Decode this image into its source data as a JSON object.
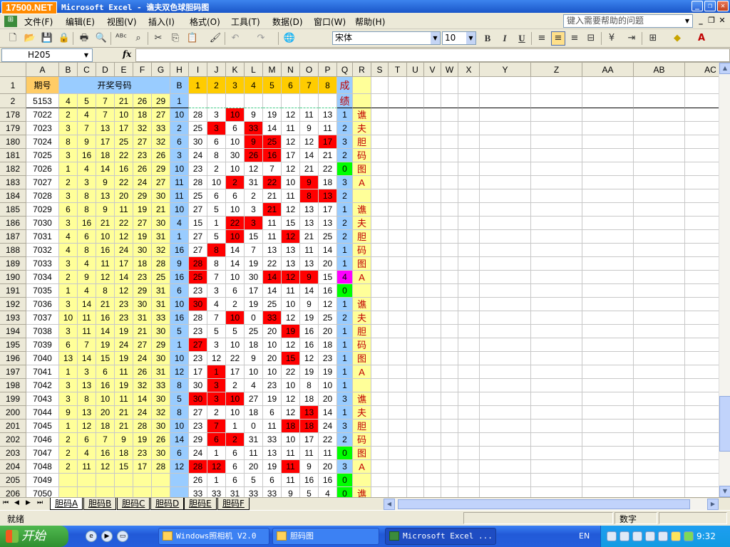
{
  "title_bar": {
    "logo_text": "17500.NET",
    "title": "Microsoft Excel - 谯夫双色球胆码图",
    "window_buttons": [
      "_",
      "❐",
      "✕"
    ]
  },
  "menu": {
    "items": [
      "文件(F)",
      "编辑(E)",
      "视图(V)",
      "插入(I)",
      "格式(O)",
      "工具(T)",
      "数据(D)",
      "窗口(W)",
      "帮助(H)"
    ],
    "help_placeholder": "键入需要帮助的问题",
    "mdi_buttons": [
      "_",
      "❐",
      "✕"
    ]
  },
  "toolbar": {
    "font_name": "宋体",
    "font_size": "10",
    "bold": "B",
    "italic": "I",
    "underline": "U"
  },
  "formula_bar": {
    "cell_ref": "H205",
    "fx": "fx",
    "content": ""
  },
  "columns": [
    "A",
    "B",
    "C",
    "D",
    "E",
    "F",
    "G",
    "H",
    "I",
    "J",
    "K",
    "L",
    "M",
    "N",
    "O",
    "P",
    "Q",
    "R",
    "S",
    "T",
    "U",
    "V",
    "W",
    "X",
    "Y",
    "Z",
    "AA",
    "AB",
    "AC"
  ],
  "header_rows": [
    {
      "row": "1",
      "label_a": "期号",
      "label_bg": "开奖号码",
      "label_h": "B",
      "cols_ip": [
        "1",
        "2",
        "3",
        "4",
        "5",
        "6",
        "7",
        "8"
      ],
      "label_q": "成"
    },
    {
      "row": "2",
      "a": "5153",
      "bg": [
        "4",
        "5",
        "7",
        "21",
        "26",
        "29"
      ],
      "h": "1",
      "label_q": "绩"
    }
  ],
  "rows": [
    {
      "n": "178",
      "a": "7022",
      "bg": [
        "2",
        "4",
        "7",
        "10",
        "18",
        "27"
      ],
      "h": "10",
      "ip": [
        "28",
        "3",
        "10",
        "9",
        "19",
        "12",
        "11",
        "13"
      ],
      "red": [
        2
      ],
      "q": "1",
      "qc": "b",
      "r": "谯"
    },
    {
      "n": "179",
      "a": "7023",
      "bg": [
        "3",
        "7",
        "13",
        "17",
        "32",
        "33"
      ],
      "h": "2",
      "ip": [
        "25",
        "3",
        "6",
        "33",
        "14",
        "11",
        "9",
        "11"
      ],
      "red": [
        1,
        3
      ],
      "q": "2",
      "qc": "b",
      "r": "夫"
    },
    {
      "n": "180",
      "a": "7024",
      "bg": [
        "8",
        "9",
        "17",
        "25",
        "27",
        "32"
      ],
      "h": "6",
      "ip": [
        "30",
        "6",
        "10",
        "9",
        "25",
        "12",
        "12",
        "17"
      ],
      "red": [
        3,
        4,
        7
      ],
      "q": "3",
      "qc": "b",
      "r": "胆"
    },
    {
      "n": "181",
      "a": "7025",
      "bg": [
        "3",
        "16",
        "18",
        "22",
        "23",
        "26"
      ],
      "h": "3",
      "ip": [
        "24",
        "8",
        "30",
        "26",
        "16",
        "17",
        "14",
        "21"
      ],
      "red": [
        3,
        4
      ],
      "q": "2",
      "qc": "b",
      "r": "码"
    },
    {
      "n": "182",
      "a": "7026",
      "bg": [
        "1",
        "4",
        "14",
        "16",
        "26",
        "29"
      ],
      "h": "10",
      "ip": [
        "23",
        "2",
        "10",
        "12",
        "7",
        "12",
        "21",
        "22"
      ],
      "red": [],
      "q": "0",
      "qc": "g",
      "r": "图"
    },
    {
      "n": "183",
      "a": "7027",
      "bg": [
        "2",
        "3",
        "9",
        "22",
        "24",
        "27"
      ],
      "h": "11",
      "ip": [
        "28",
        "10",
        "2",
        "31",
        "22",
        "10",
        "9",
        "18"
      ],
      "red": [
        2,
        4,
        6
      ],
      "q": "3",
      "qc": "b",
      "r": "A"
    },
    {
      "n": "184",
      "a": "7028",
      "bg": [
        "3",
        "8",
        "13",
        "20",
        "29",
        "30"
      ],
      "h": "11",
      "ip": [
        "25",
        "6",
        "6",
        "2",
        "21",
        "11",
        "8",
        "13"
      ],
      "red": [
        6,
        7
      ],
      "q": "2",
      "qc": "b",
      "r": ""
    },
    {
      "n": "185",
      "a": "7029",
      "bg": [
        "6",
        "8",
        "9",
        "11",
        "19",
        "21"
      ],
      "h": "10",
      "ip": [
        "27",
        "5",
        "10",
        "3",
        "21",
        "12",
        "13",
        "17"
      ],
      "red": [
        4
      ],
      "q": "1",
      "qc": "b",
      "r": "谯"
    },
    {
      "n": "186",
      "a": "7030",
      "bg": [
        "3",
        "16",
        "21",
        "22",
        "27",
        "30"
      ],
      "h": "4",
      "ip": [
        "15",
        "1",
        "22",
        "3",
        "11",
        "15",
        "13",
        "13"
      ],
      "red": [
        2,
        3
      ],
      "q": "2",
      "qc": "b",
      "r": "夫"
    },
    {
      "n": "187",
      "a": "7031",
      "bg": [
        "4",
        "6",
        "10",
        "12",
        "19",
        "31"
      ],
      "h": "1",
      "ip": [
        "27",
        "5",
        "10",
        "15",
        "11",
        "12",
        "21",
        "25"
      ],
      "red": [
        2,
        5
      ],
      "q": "2",
      "qc": "b",
      "r": "胆"
    },
    {
      "n": "188",
      "a": "7032",
      "bg": [
        "4",
        "8",
        "16",
        "24",
        "30",
        "32"
      ],
      "h": "16",
      "ip": [
        "27",
        "8",
        "14",
        "7",
        "13",
        "13",
        "11",
        "14"
      ],
      "red": [
        1
      ],
      "q": "1",
      "qc": "b",
      "r": "码"
    },
    {
      "n": "189",
      "a": "7033",
      "bg": [
        "3",
        "4",
        "11",
        "17",
        "18",
        "28"
      ],
      "h": "9",
      "ip": [
        "28",
        "8",
        "14",
        "19",
        "22",
        "13",
        "13",
        "20"
      ],
      "red": [
        0
      ],
      "q": "1",
      "qc": "b",
      "r": "图"
    },
    {
      "n": "190",
      "a": "7034",
      "bg": [
        "2",
        "9",
        "12",
        "14",
        "23",
        "25"
      ],
      "h": "16",
      "ip": [
        "25",
        "7",
        "10",
        "30",
        "14",
        "12",
        "9",
        "15"
      ],
      "red": [
        0,
        4,
        5,
        6
      ],
      "q": "4",
      "qc": "m",
      "r": "A"
    },
    {
      "n": "191",
      "a": "7035",
      "bg": [
        "1",
        "4",
        "8",
        "12",
        "29",
        "31"
      ],
      "h": "6",
      "ip": [
        "23",
        "3",
        "6",
        "17",
        "14",
        "11",
        "14",
        "16"
      ],
      "red": [],
      "q": "0",
      "qc": "g",
      "r": ""
    },
    {
      "n": "192",
      "a": "7036",
      "bg": [
        "3",
        "14",
        "21",
        "23",
        "30",
        "31"
      ],
      "h": "10",
      "ip": [
        "30",
        "4",
        "2",
        "19",
        "25",
        "10",
        "9",
        "12"
      ],
      "red": [
        0
      ],
      "q": "1",
      "qc": "b",
      "r": "谯"
    },
    {
      "n": "193",
      "a": "7037",
      "bg": [
        "10",
        "11",
        "16",
        "23",
        "31",
        "33"
      ],
      "h": "16",
      "ip": [
        "28",
        "7",
        "10",
        "0",
        "33",
        "12",
        "19",
        "25"
      ],
      "red": [
        2,
        4
      ],
      "q": "2",
      "qc": "b",
      "r": "夫"
    },
    {
      "n": "194",
      "a": "7038",
      "bg": [
        "3",
        "11",
        "14",
        "19",
        "21",
        "30"
      ],
      "h": "5",
      "ip": [
        "23",
        "5",
        "5",
        "25",
        "20",
        "19",
        "16",
        "20"
      ],
      "red": [
        5
      ],
      "q": "1",
      "qc": "b",
      "r": "胆"
    },
    {
      "n": "195",
      "a": "7039",
      "bg": [
        "6",
        "7",
        "19",
        "24",
        "27",
        "29"
      ],
      "h": "1",
      "ip": [
        "27",
        "3",
        "10",
        "18",
        "10",
        "12",
        "16",
        "18"
      ],
      "red": [
        0
      ],
      "q": "1",
      "qc": "b",
      "r": "码"
    },
    {
      "n": "196",
      "a": "7040",
      "bg": [
        "13",
        "14",
        "15",
        "19",
        "24",
        "30"
      ],
      "h": "10",
      "ip": [
        "23",
        "12",
        "22",
        "9",
        "20",
        "15",
        "12",
        "23"
      ],
      "red": [
        5
      ],
      "q": "1",
      "qc": "b",
      "r": "图"
    },
    {
      "n": "197",
      "a": "7041",
      "bg": [
        "1",
        "3",
        "6",
        "11",
        "26",
        "31"
      ],
      "h": "12",
      "ip": [
        "17",
        "1",
        "17",
        "10",
        "10",
        "22",
        "19",
        "19"
      ],
      "red": [
        1
      ],
      "q": "1",
      "qc": "b",
      "r": "A"
    },
    {
      "n": "198",
      "a": "7042",
      "bg": [
        "3",
        "13",
        "16",
        "19",
        "32",
        "33"
      ],
      "h": "8",
      "ip": [
        "30",
        "3",
        "2",
        "4",
        "23",
        "10",
        "8",
        "10"
      ],
      "red": [
        1
      ],
      "q": "1",
      "qc": "b",
      "r": ""
    },
    {
      "n": "199",
      "a": "7043",
      "bg": [
        "3",
        "8",
        "10",
        "11",
        "14",
        "30"
      ],
      "h": "5",
      "ip": [
        "30",
        "3",
        "10",
        "27",
        "19",
        "12",
        "18",
        "20"
      ],
      "red": [
        0,
        1,
        2
      ],
      "q": "3",
      "qc": "b",
      "r": "谯"
    },
    {
      "n": "200",
      "a": "7044",
      "bg": [
        "9",
        "13",
        "20",
        "21",
        "24",
        "32"
      ],
      "h": "8",
      "ip": [
        "27",
        "2",
        "10",
        "18",
        "6",
        "12",
        "13",
        "14"
      ],
      "red": [
        6
      ],
      "q": "1",
      "qc": "b",
      "r": "夫"
    },
    {
      "n": "201",
      "a": "7045",
      "bg": [
        "1",
        "12",
        "18",
        "21",
        "28",
        "30"
      ],
      "h": "10",
      "ip": [
        "23",
        "7",
        "1",
        "0",
        "11",
        "18",
        "18",
        "24"
      ],
      "red": [
        1,
        5,
        6
      ],
      "q": "3",
      "qc": "b",
      "r": "胆"
    },
    {
      "n": "202",
      "a": "7046",
      "bg": [
        "2",
        "6",
        "7",
        "9",
        "19",
        "26"
      ],
      "h": "14",
      "ip": [
        "29",
        "6",
        "2",
        "31",
        "33",
        "10",
        "17",
        "22"
      ],
      "red": [
        1,
        2
      ],
      "q": "2",
      "qc": "b",
      "r": "码"
    },
    {
      "n": "203",
      "a": "7047",
      "bg": [
        "2",
        "4",
        "16",
        "18",
        "23",
        "30"
      ],
      "h": "6",
      "ip": [
        "24",
        "1",
        "6",
        "11",
        "13",
        "11",
        "11",
        "11"
      ],
      "red": [],
      "q": "0",
      "qc": "g",
      "r": "图"
    },
    {
      "n": "204",
      "a": "7048",
      "bg": [
        "2",
        "11",
        "12",
        "15",
        "17",
        "28"
      ],
      "h": "12",
      "ip": [
        "28",
        "12",
        "6",
        "20",
        "19",
        "11",
        "9",
        "20"
      ],
      "red": [
        0,
        1,
        5
      ],
      "q": "3",
      "qc": "b",
      "r": "A"
    },
    {
      "n": "205",
      "a": "7049",
      "bg": [
        "",
        "",
        "",
        "",
        "",
        ""
      ],
      "h": "",
      "ip": [
        "26",
        "1",
        "6",
        "5",
        "6",
        "11",
        "16",
        "16"
      ],
      "red": [],
      "q": "0",
      "qc": "g",
      "r": ""
    },
    {
      "n": "206",
      "a": "7050",
      "bg": [
        "",
        "",
        "",
        "",
        "",
        ""
      ],
      "h": "",
      "ip": [
        "33",
        "33",
        "31",
        "33",
        "33",
        "9",
        "5",
        "4"
      ],
      "red": [],
      "q": "0",
      "qc": "g",
      "r": "谯"
    }
  ],
  "sheet_tabs": [
    "胆码A",
    "胆码B",
    "胆码C",
    "胆码D",
    "胆码E",
    "胆码F"
  ],
  "tab_colors": [
    "#ffffff",
    "#ff9933",
    "#99ccff",
    "#99ff99",
    "#cc99ff",
    "#cccccc"
  ],
  "status": {
    "left": "就绪",
    "mode": "数字"
  },
  "taskbar": {
    "start": "开始",
    "tasks": [
      "Windows照相机 V2.0",
      "胆码图",
      "Microsoft Excel ..."
    ],
    "lang": "EN",
    "clock": "9:32"
  }
}
